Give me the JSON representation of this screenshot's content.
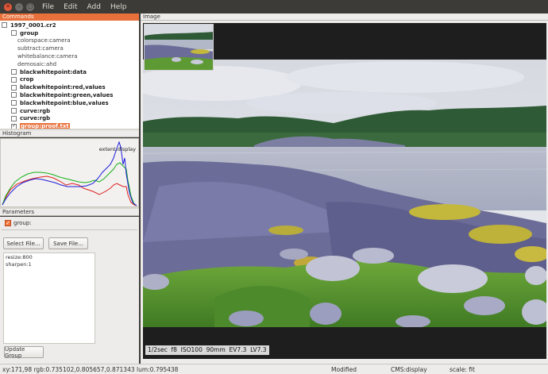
{
  "window": {
    "menu": [
      "File",
      "Edit",
      "Add",
      "Help"
    ]
  },
  "commands": {
    "title": "Commands",
    "file": "1997_0001.cr2",
    "items": [
      {
        "label": "group",
        "bold": true,
        "indent": 1,
        "checkbox": true,
        "checked": false
      },
      {
        "label": "colorspace:camera",
        "bold": false,
        "indent": 2,
        "checkbox": false
      },
      {
        "label": "subtract:camera",
        "bold": false,
        "indent": 2,
        "checkbox": false
      },
      {
        "label": "whitebalance:camera",
        "bold": false,
        "indent": 2,
        "checkbox": false
      },
      {
        "label": "demosaic:ahd",
        "bold": false,
        "indent": 2,
        "checkbox": false
      },
      {
        "label": "blackwhitepoint:data",
        "bold": true,
        "indent": 1,
        "checkbox": true,
        "checked": false
      },
      {
        "label": "crop",
        "bold": true,
        "indent": 1,
        "checkbox": true,
        "checked": false
      },
      {
        "label": "blackwhitepoint:red,values",
        "bold": true,
        "indent": 1,
        "checkbox": true,
        "checked": false
      },
      {
        "label": "blackwhitepoint:green,values",
        "bold": true,
        "indent": 1,
        "checkbox": true,
        "checked": false
      },
      {
        "label": "blackwhitepoint:blue,values",
        "bold": true,
        "indent": 1,
        "checkbox": true,
        "checked": false
      },
      {
        "label": "curve:rgb",
        "bold": true,
        "indent": 1,
        "checkbox": true,
        "checked": false
      },
      {
        "label": "curve:rgb",
        "bold": true,
        "indent": 1,
        "checkbox": true,
        "checked": false
      },
      {
        "label": "group:proof.txt",
        "bold": true,
        "indent": 1,
        "checkbox": true,
        "checked": true,
        "selected": true
      }
    ]
  },
  "histogram": {
    "title": "Histogram",
    "extent_label": "extent:display",
    "colors": {
      "red": "#e02020",
      "green": "#18b018",
      "blue": "#1c1cd8"
    }
  },
  "parameters": {
    "title": "Parameters",
    "group_label": "group:",
    "group_checked": true,
    "select_file": "Select File...",
    "save_file": "Save File...",
    "text": "resize:800\nsharpen:1",
    "update_group": "Update Group"
  },
  "image": {
    "title": "Image",
    "exif": "1/2sec  f8  ISO100  90mm  EV7.3  LV7.3"
  },
  "status": {
    "coords": "xy:171,98 rgb:0.735102,0.805657,0.871343 lum:0.795438",
    "modified": "Modified",
    "cms": "CMS:display",
    "scale": "scale: fit"
  }
}
